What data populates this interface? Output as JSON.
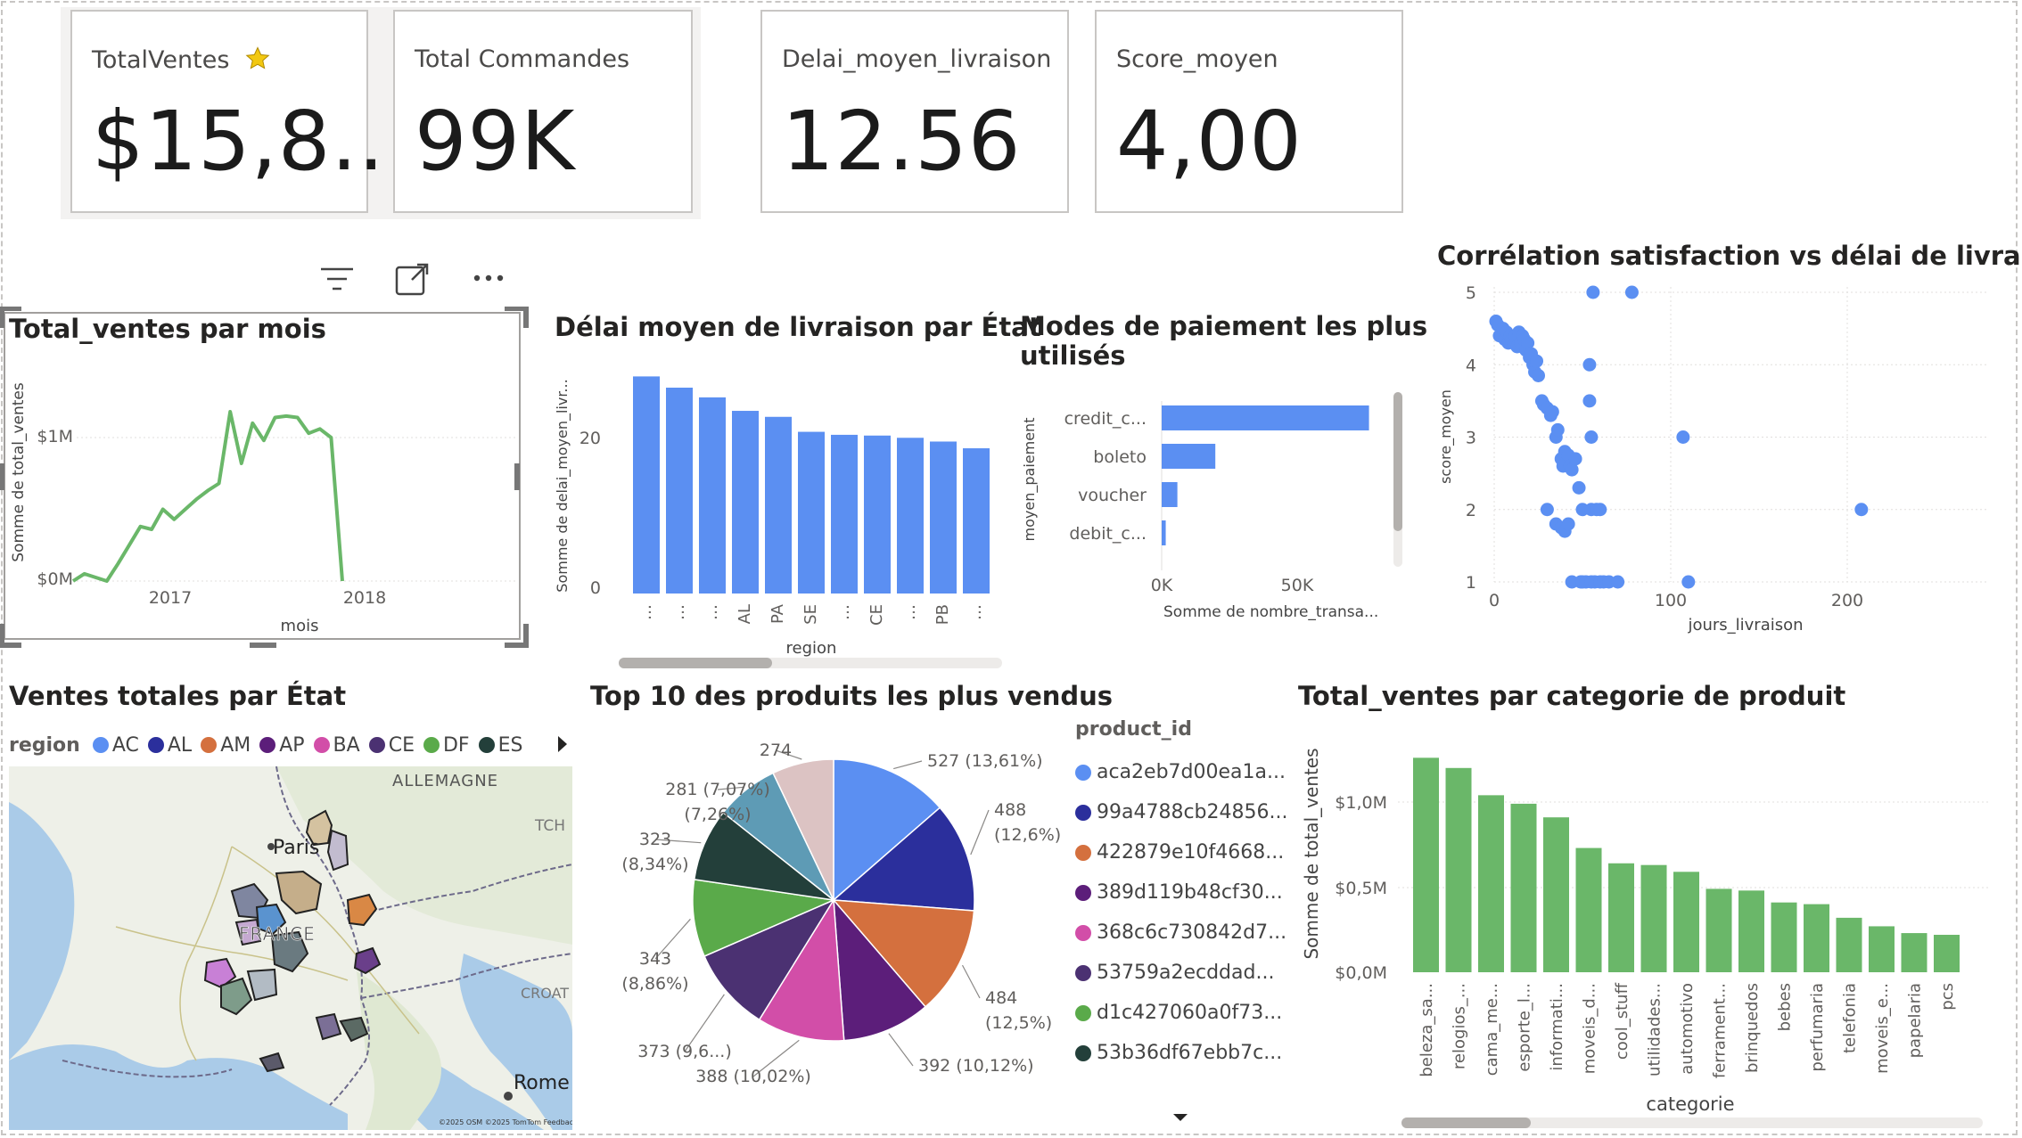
{
  "kpis": [
    {
      "label": "TotalVentes",
      "value": "$15,8...",
      "has_star": true
    },
    {
      "label": "Total Commandes",
      "value": "99K",
      "has_star": false
    },
    {
      "label": "Delai_moyen_livraison",
      "value": "12.56",
      "has_star": false
    },
    {
      "label": "Score_moyen",
      "value": "4,00",
      "has_star": false
    }
  ],
  "icons": {
    "filter": "filter-icon",
    "focus": "focus-mode-icon",
    "more": "more-options-icon",
    "star": "star-icon",
    "legend_next": "chevron-right-icon",
    "scroll_down": "caret-down-icon"
  },
  "colors": {
    "green": "#6ab769",
    "blue": "#5b8ff2",
    "border": "#c8c6c4"
  },
  "line_chart": {
    "title": "Total_ventes par mois",
    "ylabel": "Somme de total_ventes",
    "xlabel": "mois",
    "yticks": [
      "$1M",
      "$0M"
    ],
    "xticks": [
      "2017",
      "2018"
    ]
  },
  "delai_chart": {
    "title": "Délai moyen de livraison par État",
    "ylabel": "Somme de delai_moyen_livr...",
    "xlabel": "region",
    "yticks": [
      "20",
      "0"
    ],
    "xtick_labels": [
      "…",
      "…",
      "…",
      "AL",
      "PA",
      "SE",
      "…",
      "CE",
      "…",
      "PB",
      "…"
    ]
  },
  "payment_chart": {
    "title_line1": "Modes de paiement les plus",
    "title_line2": "utilisés",
    "ylabel": "moyen_paiement",
    "xlabel": "Somme de nombre_transa...",
    "categories": [
      "credit_c...",
      "boleto",
      "voucher",
      "debit_c..."
    ],
    "xticks": [
      "0K",
      "50K"
    ]
  },
  "scatter_chart": {
    "title": "Corrélation satisfaction vs délai de livraison",
    "ylabel": "score_moyen",
    "xlabel": "jours_livraison",
    "yticks": [
      "5",
      "4",
      "3",
      "2",
      "1"
    ],
    "xticks": [
      "0",
      "100",
      "200"
    ]
  },
  "map": {
    "title": "Ventes totales par État",
    "legend_label": "region",
    "legend": [
      {
        "code": "AC",
        "color": "#5b8ff2"
      },
      {
        "code": "AL",
        "color": "#2b2f9c"
      },
      {
        "code": "AM",
        "color": "#d4703e"
      },
      {
        "code": "AP",
        "color": "#5c1e7a"
      },
      {
        "code": "BA",
        "color": "#d24ea8"
      },
      {
        "code": "CE",
        "color": "#4b3172"
      },
      {
        "code": "DF",
        "color": "#5aaa4a"
      },
      {
        "code": "ES",
        "color": "#233f3a"
      }
    ],
    "places": {
      "germany": "ALLEMAGNE",
      "paris": "Paris",
      "france": "FRANCE",
      "rome": "Rome",
      "croatia": "CROAT",
      "czech": "TCH"
    },
    "attribution": "©2025 OSM ©2025 TomTom Feedback"
  },
  "pie_chart": {
    "title": "Top 10 des produits les plus vendus",
    "legend_title": "product_id",
    "slice_labels": [
      "527 (13,61%)",
      "488\n(12,6%)",
      "484\n(12,5%)",
      "392 (10,12%)",
      "388 (10,02%)",
      "373 (9,6...)",
      "343\n(8,86%)",
      "323\n(8,34%)",
      "281 (7,07%)\n(7,26%)",
      "274"
    ],
    "legend": [
      {
        "id": "aca2eb7d00ea1a...",
        "color": "#5b8ff2"
      },
      {
        "id": "99a4788cb24856...",
        "color": "#2b2f9c"
      },
      {
        "id": "422879e10f4668...",
        "color": "#d4703e"
      },
      {
        "id": "389d119b48cf30...",
        "color": "#5c1e7a"
      },
      {
        "id": "368c6c730842d7...",
        "color": "#d24ea8"
      },
      {
        "id": "53759a2ecddad...",
        "color": "#4b3172"
      },
      {
        "id": "d1c427060a0f73...",
        "color": "#5aaa4a"
      },
      {
        "id": "53b36df67ebb7c...",
        "color": "#233f3a"
      }
    ]
  },
  "category_chart": {
    "title": "Total_ventes par categorie de produit",
    "ylabel": "Somme de total_ventes",
    "xlabel": "categorie",
    "yticks": [
      "$1,0M",
      "$0,5M",
      "$0,0M"
    ]
  },
  "chart_data": [
    {
      "type": "line",
      "title": "Total_ventes par mois",
      "xlabel": "mois",
      "ylabel": "Somme de total_ventes",
      "x": [
        "2016-09",
        "2016-10",
        "2016-12",
        "2017-01",
        "2017-02",
        "2017-03",
        "2017-04",
        "2017-05",
        "2017-06",
        "2017-07",
        "2017-08",
        "2017-09",
        "2017-10",
        "2017-11",
        "2017-12",
        "2018-01",
        "2018-02",
        "2018-03",
        "2018-04",
        "2018-05",
        "2018-06",
        "2018-07",
        "2018-08",
        "2018-09"
      ],
      "values": [
        0.0,
        0.05,
        0.0,
        0.12,
        0.25,
        0.38,
        0.36,
        0.5,
        0.43,
        0.5,
        0.57,
        0.63,
        0.68,
        1.18,
        0.82,
        1.1,
        0.98,
        1.14,
        1.15,
        1.14,
        1.03,
        1.06,
        1.0,
        0.0
      ],
      "unit": "$M",
      "ylim": [
        0,
        1.2
      ],
      "grid": true
    },
    {
      "type": "bar",
      "title": "Délai moyen de livraison par État",
      "xlabel": "region",
      "ylabel": "Somme de delai_moyen_livr...",
      "categories": [
        "…",
        "…",
        "…",
        "AL",
        "PA",
        "SE",
        "…",
        "CE",
        "…",
        "PB",
        "…"
      ],
      "values": [
        29,
        27.5,
        26.2,
        24.4,
        23.6,
        21.6,
        21.2,
        21.1,
        20.8,
        20.3,
        19.4
      ],
      "ylim": [
        0,
        30
      ]
    },
    {
      "type": "bar",
      "orientation": "horizontal",
      "title": "Modes de paiement les plus utilisés",
      "xlabel": "Somme de nombre_transa...",
      "ylabel": "moyen_paiement",
      "categories": [
        "credit_c...",
        "boleto",
        "voucher",
        "debit_c..."
      ],
      "values": [
        76500,
        19800,
        5800,
        1500
      ],
      "xlim": [
        0,
        80000
      ]
    },
    {
      "type": "scatter",
      "title": "Corrélation satisfaction vs délai de livraison",
      "xlabel": "jours_livraison",
      "ylabel": "score_moyen",
      "points": [
        [
          1,
          4.6
        ],
        [
          2,
          4.55
        ],
        [
          3,
          4.4
        ],
        [
          5,
          4.5
        ],
        [
          6,
          4.35
        ],
        [
          7,
          4.45
        ],
        [
          8,
          4.3
        ],
        [
          9,
          4.4
        ],
        [
          10,
          4.35
        ],
        [
          11,
          4.3
        ],
        [
          12,
          4.4
        ],
        [
          13,
          4.25
        ],
        [
          14,
          4.45
        ],
        [
          15,
          4.3
        ],
        [
          16,
          4.4
        ],
        [
          17,
          4.35
        ],
        [
          18,
          4.2
        ],
        [
          19,
          4.3
        ],
        [
          20,
          4.1
        ],
        [
          21,
          4.15
        ],
        [
          22,
          4.0
        ],
        [
          23,
          3.9
        ],
        [
          24,
          4.05
        ],
        [
          25,
          3.85
        ],
        [
          27,
          3.5
        ],
        [
          28,
          3.45
        ],
        [
          30,
          3.4
        ],
        [
          32,
          3.3
        ],
        [
          33,
          3.35
        ],
        [
          35,
          3.0
        ],
        [
          36,
          3.1
        ],
        [
          38,
          2.7
        ],
        [
          39,
          2.6
        ],
        [
          40,
          2.8
        ],
        [
          42,
          2.75
        ],
        [
          43,
          2.6
        ],
        [
          44,
          2.55
        ],
        [
          46,
          2.7
        ],
        [
          48,
          2.3
        ],
        [
          30,
          2.0
        ],
        [
          35,
          1.8
        ],
        [
          38,
          1.75
        ],
        [
          40,
          1.7
        ],
        [
          42,
          1.8
        ],
        [
          44,
          1.0
        ],
        [
          49,
          1.0
        ],
        [
          50,
          1.0
        ],
        [
          52,
          1.0
        ],
        [
          55,
          1.0
        ],
        [
          57,
          1.0
        ],
        [
          60,
          1.0
        ],
        [
          62,
          1.0
        ],
        [
          65,
          1.0
        ],
        [
          70,
          1.0
        ],
        [
          50,
          2.0
        ],
        [
          55,
          2.0
        ],
        [
          58,
          2.0
        ],
        [
          60,
          2.0
        ],
        [
          54,
          3.5
        ],
        [
          55,
          3.0
        ],
        [
          54,
          4.0
        ],
        [
          56,
          5.0
        ],
        [
          78,
          5.0
        ],
        [
          107,
          3.0
        ],
        [
          110,
          1.0
        ],
        [
          208,
          2.0
        ]
      ],
      "xlim": [
        0,
        260
      ],
      "ylim": [
        1,
        5
      ],
      "grid": true
    },
    {
      "type": "pie",
      "title": "Top 10 des produits les plus vendus",
      "slices": [
        {
          "label": "aca2eb7d00ea1a...",
          "value": 527,
          "pct": "13,61%",
          "color": "#5b8ff2"
        },
        {
          "label": "99a4788cb24856...",
          "value": 488,
          "pct": "12,6%",
          "color": "#2b2f9c"
        },
        {
          "label": "422879e10f4668...",
          "value": 484,
          "pct": "12,5%",
          "color": "#d4703e"
        },
        {
          "label": "389d119b48cf30...",
          "value": 392,
          "pct": "10,12%",
          "color": "#5c1e7a"
        },
        {
          "label": "368c6c730842d7...",
          "value": 388,
          "pct": "10,02%",
          "color": "#d24ea8"
        },
        {
          "label": "53759a2ecddad...",
          "value": 373,
          "pct": "9,6...",
          "color": "#4b3172"
        },
        {
          "label": "d1c427060a0f73...",
          "value": 343,
          "pct": "8,86%",
          "color": "#5aaa4a"
        },
        {
          "label": "53b36df67ebb7c...",
          "value": 323,
          "pct": "8,34%",
          "color": "#233f3a"
        },
        {
          "label": "",
          "value": 281,
          "pct": "7,26%",
          "color": "#5e9bb5"
        },
        {
          "label": "",
          "value": 274,
          "pct": "7,07%",
          "color": "#dcc3c3"
        }
      ]
    },
    {
      "type": "bar",
      "title": "Total_ventes par categorie de produit",
      "xlabel": "categorie",
      "ylabel": "Somme de total_ventes",
      "categories": [
        "beleza_sa...",
        "relogios_...",
        "cama_me...",
        "esporte_l...",
        "informati...",
        "moveis_d...",
        "cool_stuff",
        "utilidades...",
        "automotivo",
        "ferrament...",
        "brinquedos",
        "bebes",
        "perfumaria",
        "telefonia",
        "moveis_e...",
        "papelaria",
        "pcs"
      ],
      "values": [
        1.26,
        1.2,
        1.04,
        0.99,
        0.91,
        0.73,
        0.64,
        0.63,
        0.59,
        0.49,
        0.48,
        0.41,
        0.4,
        0.32,
        0.27,
        0.23,
        0.22
      ],
      "unit": "$M",
      "ylim": [
        0,
        1.3
      ]
    }
  ]
}
